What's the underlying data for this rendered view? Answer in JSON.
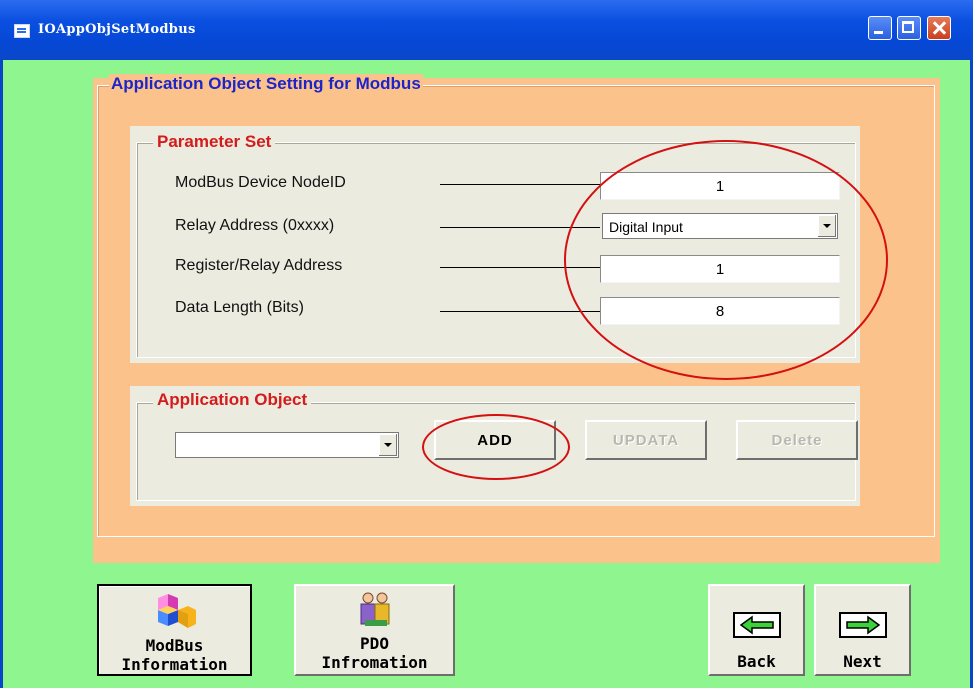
{
  "window": {
    "title": "IOAppObjSetModbus"
  },
  "main_group": {
    "title": "Application Object Setting for Modbus"
  },
  "parameter_set": {
    "title": "Parameter Set",
    "node_id": {
      "label": "ModBus Device NodeID",
      "value": "1"
    },
    "relay_address": {
      "label": "Relay Address (0xxxx)",
      "value": "Digital Input"
    },
    "register_address": {
      "label": "Register/Relay Address",
      "value": "1"
    },
    "data_length": {
      "label": "Data Length (Bits)",
      "value": "8"
    }
  },
  "application_object": {
    "title": "Application Object",
    "selected": "",
    "add_label": "ADD",
    "update_label": "UPDATA",
    "delete_label": "Delete"
  },
  "bottom": {
    "modbus": {
      "line1": "ModBus",
      "line2": "Information"
    },
    "pdo": {
      "line1": "PDO",
      "line2": "Infromation"
    },
    "back_label": "Back",
    "next_label": "Next"
  },
  "colors": {
    "background": "#8ff58f",
    "panel": "#fbc38b",
    "group": "#ecebe0",
    "accent_red": "#d41010",
    "title_blue": "#1d25c8"
  },
  "icons": [
    "window-app-icon",
    "minimize-icon",
    "maximize-icon",
    "close-icon",
    "chevron-down-icon",
    "cubes-icon",
    "people-icon",
    "arrow-left-icon",
    "arrow-right-icon"
  ]
}
